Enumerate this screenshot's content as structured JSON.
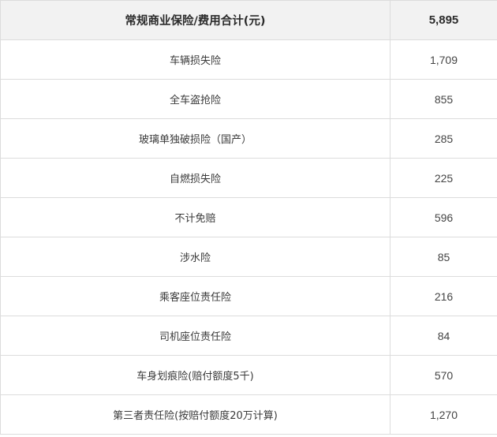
{
  "table": {
    "header": {
      "label": "常规商业保险/费用合计(元)",
      "value": "5,895"
    },
    "rows": [
      {
        "label": "车辆损失险",
        "value": "1,709"
      },
      {
        "label": "全车盗抢险",
        "value": "855"
      },
      {
        "label": "玻璃单独破损险（国产）",
        "value": "285"
      },
      {
        "label": "自燃损失险",
        "value": "225"
      },
      {
        "label": "不计免赔",
        "value": "596"
      },
      {
        "label": "涉水险",
        "value": "85"
      },
      {
        "label": "乘客座位责任险",
        "value": "216"
      },
      {
        "label": "司机座位责任险",
        "value": "84"
      },
      {
        "label": "车身划痕险(赔付额度5千)",
        "value": "570"
      },
      {
        "label": "第三者责任险(按赔付额度20万计算)",
        "value": "1,270"
      }
    ]
  }
}
